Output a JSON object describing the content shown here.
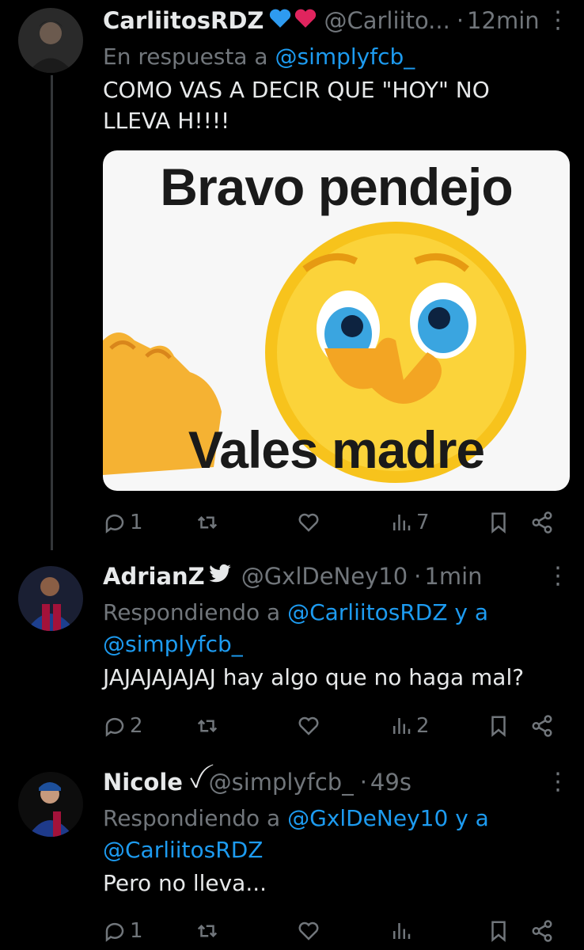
{
  "tweets": [
    {
      "name": "CarliitosRDZ",
      "badges": [
        "blue-heart",
        "red-heart"
      ],
      "handle": "@Carliito...",
      "dot": "·",
      "time": "12min",
      "reply_prefix": "En respuesta a",
      "reply_mentions": [
        "@simplyfcb_"
      ],
      "text": "COMO VAS A DECIR QUE \"HOY\" NO LLEVA H!!!!",
      "media": {
        "top_text": "Bravo pendejo",
        "bottom_text": "Vales madre"
      },
      "actions": {
        "replies": "1",
        "retweets": "",
        "likes": "",
        "views": "7"
      }
    },
    {
      "name": "AdrianZ",
      "badges": [
        "twitter-bird"
      ],
      "handle": "@GxlDeNey10",
      "dot": "·",
      "time": "1min",
      "reply_prefix": "Respondiendo a",
      "reply_mentions": [
        "@CarliitosRDZ",
        "@simplyfcb_"
      ],
      "reply_joiner": "y a",
      "text": "JAJAJAJAJAJ hay algo que no haga mal?",
      "actions": {
        "replies": "2",
        "retweets": "",
        "likes": "",
        "views": "2"
      }
    },
    {
      "name": "Nicole",
      "badges": [
        "symbol"
      ],
      "badge_glyph": "ꪜ",
      "handle": "@simplyfcb_",
      "dot": "·",
      "time": "49s",
      "reply_prefix": "Respondiendo a",
      "reply_mentions": [
        "@GxlDeNey10",
        "@CarliitosRDZ"
      ],
      "reply_joiner": "y a",
      "text": "Pero no lleva...",
      "actions": {
        "replies": "1",
        "retweets": "",
        "likes": "",
        "views": ""
      }
    }
  ],
  "colors": {
    "background": "#000000",
    "text": "#e7e9ea",
    "muted": "#71767b",
    "link": "#1d9bf0"
  }
}
